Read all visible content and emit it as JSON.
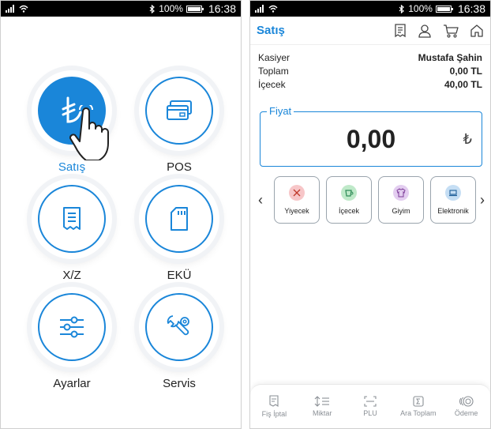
{
  "status_bar": {
    "battery": "100%",
    "time": "16:38"
  },
  "left_screen": {
    "menu": [
      {
        "label": "Satış",
        "icon": "lira-icon",
        "active": true
      },
      {
        "label": "POS",
        "icon": "credit-card-icon",
        "active": false
      },
      {
        "label": "X/Z",
        "icon": "receipt-icon",
        "active": false
      },
      {
        "label": "EKÜ",
        "icon": "memory-card-icon",
        "active": false
      },
      {
        "label": "Ayarlar",
        "icon": "sliders-icon",
        "active": false
      },
      {
        "label": "Servis",
        "icon": "tools-icon",
        "active": false
      }
    ],
    "pointer_icon": "hand-pointer-icon"
  },
  "right_screen": {
    "title": "Satış",
    "header_icons": [
      "receipt-icon",
      "user-icon",
      "cart-icon",
      "home-icon"
    ],
    "info": [
      {
        "label": "Kasiyer",
        "value": "Mustafa Şahin"
      },
      {
        "label": "Toplam",
        "value": "0,00 TL"
      },
      {
        "label": "İçecek",
        "value": "40,00 TL"
      }
    ],
    "price": {
      "legend": "Fiyat",
      "value": "0,00",
      "currency": "₺"
    },
    "categories": [
      {
        "label": "Yiyecek",
        "icon": "utensils-icon",
        "color": "#f7c6c8"
      },
      {
        "label": "İçecek",
        "icon": "cup-icon",
        "color": "#bfe9c9"
      },
      {
        "label": "Giyim",
        "icon": "shirt-icon",
        "color": "#e3cdf0"
      },
      {
        "label": "Elektronik",
        "icon": "laptop-icon",
        "color": "#c5def4"
      }
    ],
    "bottom_bar": [
      {
        "label": "Fiş İptal",
        "icon": "receipt-cancel-icon"
      },
      {
        "label": "Miktar",
        "icon": "quantity-icon"
      },
      {
        "label": "PLU",
        "icon": "barcode-scan-icon"
      },
      {
        "label": "Ara Toplam",
        "icon": "sum-icon"
      },
      {
        "label": "Ödeme",
        "icon": "coins-icon"
      }
    ]
  },
  "colors": {
    "accent": "#1a86d9"
  }
}
